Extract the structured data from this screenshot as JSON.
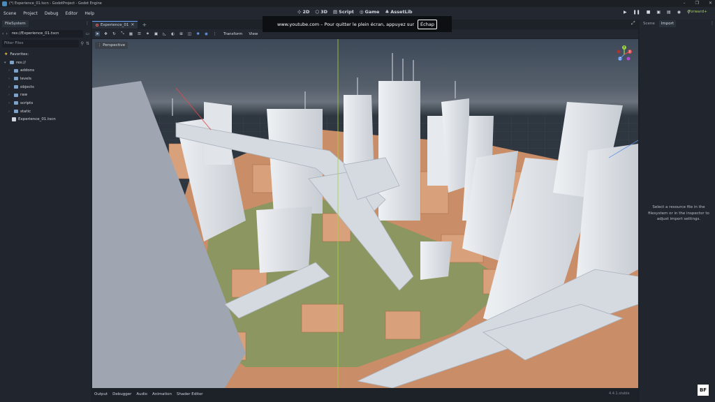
{
  "window": {
    "title": "(*) Experience_01.tscn - GodotProject - Godot Engine"
  },
  "menus": [
    "Scene",
    "Project",
    "Debug",
    "Editor",
    "Help"
  ],
  "main_screens": [
    {
      "label": "2D",
      "icon": "2d-icon"
    },
    {
      "label": "3D",
      "icon": "3d-icon"
    },
    {
      "label": "Script",
      "icon": "script-icon"
    },
    {
      "label": "Game",
      "icon": "game-icon"
    },
    {
      "label": "AssetLib",
      "icon": "assetlib-icon"
    }
  ],
  "renderer": "Forward+",
  "filesystem": {
    "tab": "FileSystem",
    "path": "res://Experience_01.tscn",
    "filter_placeholder": "Filter Files",
    "tree": [
      {
        "label": "Favorites:",
        "type": "favorites"
      },
      {
        "label": "res://",
        "type": "root"
      },
      {
        "label": "addons",
        "type": "folder"
      },
      {
        "label": "levels",
        "type": "folder"
      },
      {
        "label": "objects",
        "type": "folder"
      },
      {
        "label": "raw",
        "type": "folder"
      },
      {
        "label": "scripts",
        "type": "folder"
      },
      {
        "label": "static",
        "type": "folder"
      },
      {
        "label": "Experience_01.tscn",
        "type": "scene"
      }
    ]
  },
  "editor": {
    "scene_tab": "Experience_01",
    "toolbar_menus": [
      "Transform",
      "View"
    ],
    "viewport_mode": "Perspective",
    "gizmo_labels": {
      "x": "X",
      "y": "Y",
      "z": "Z"
    }
  },
  "bottom_panel": {
    "tabs": [
      "Output",
      "Debugger",
      "Audio",
      "Animation",
      "Shader Editor"
    ],
    "version": "4.4.1.stable"
  },
  "inspector": {
    "tabs": [
      "Scene",
      "Import"
    ],
    "message": "Select a resource file in the filesystem or in the inspector to adjust import settings."
  },
  "fullscreen_banner": {
    "text": "www.youtube.com – Pour quitter le plein écran, appuyez sur",
    "key": "Échap"
  },
  "watermark": "BF",
  "colors": {
    "accent": "#6aa6ff",
    "renderer": "#9fd64a",
    "building": "#dfe3e8",
    "ground": "#d39872",
    "grass": "#5a9e5a"
  }
}
